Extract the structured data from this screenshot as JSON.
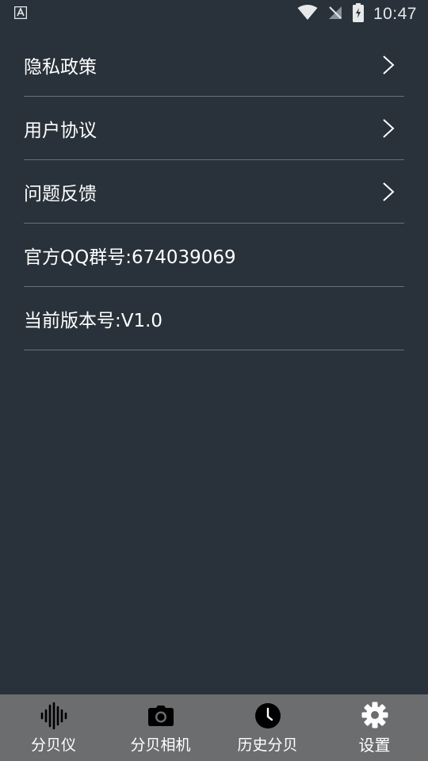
{
  "status_bar": {
    "time": "10:47",
    "icons": [
      "app-notification-icon",
      "wifi-icon",
      "no-sim-icon",
      "battery-charging-icon"
    ]
  },
  "menu": {
    "items": [
      {
        "label": "隐私政策",
        "has_chevron": true
      },
      {
        "label": "用户协议",
        "has_chevron": true
      },
      {
        "label": "问题反馈",
        "has_chevron": true
      },
      {
        "label": "官方QQ群号:674039069",
        "has_chevron": false
      },
      {
        "label": "当前版本号:V1.0",
        "has_chevron": false
      }
    ]
  },
  "bottom_nav": {
    "items": [
      {
        "label": "分贝仪",
        "icon": "sound-wave-icon",
        "active": false
      },
      {
        "label": "分贝相机",
        "icon": "camera-icon",
        "active": false
      },
      {
        "label": "历史分贝",
        "icon": "clock-icon",
        "active": false
      },
      {
        "label": "设置",
        "icon": "gear-icon",
        "active": true
      }
    ]
  },
  "colors": {
    "background": "#29323a",
    "divider": "#66707a",
    "nav_background": "#6c6d6f",
    "text": "#ffffff"
  }
}
